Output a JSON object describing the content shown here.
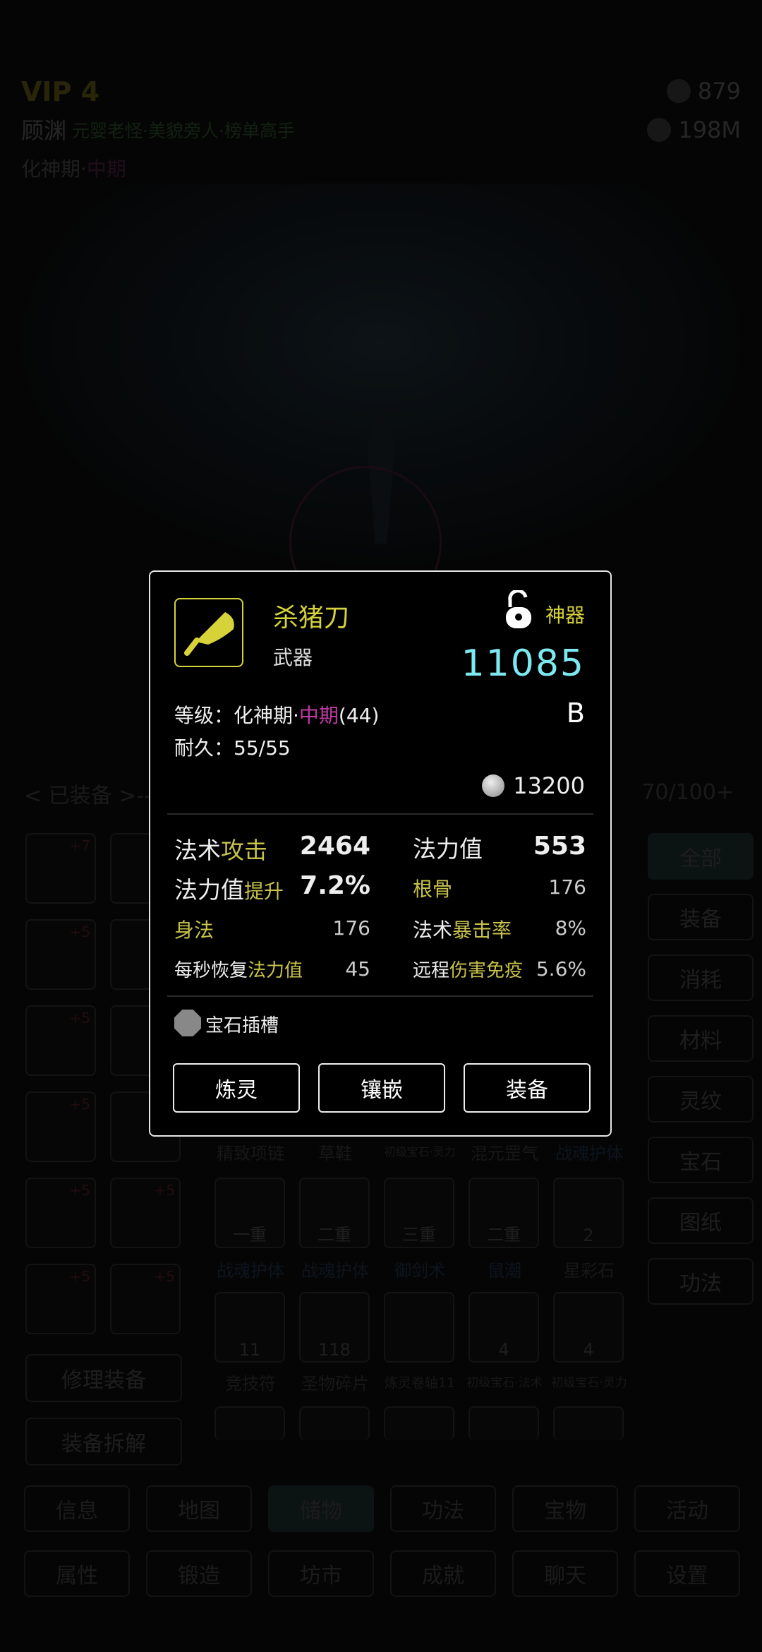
{
  "header": {
    "vip": "VIP 4",
    "player_name": "顾渊",
    "player_titles": "元婴老怪·美貌旁人·榜单高手",
    "realm_prefix": "化神期·",
    "realm_stage": "中期",
    "resource1": "879",
    "resource2": "198M"
  },
  "inventory": {
    "equipped_label": "< 已装备 >----",
    "capacity": "70/100+",
    "equipped_plus": [
      "+7",
      "",
      "+5",
      "",
      "+5",
      "",
      "+5",
      "",
      "+5",
      "+5",
      "+5",
      "+5"
    ],
    "filters": [
      "全部",
      "装备",
      "消耗",
      "材料",
      "灵纹",
      "宝石",
      "图纸",
      "功法"
    ],
    "row_labels_1": [
      "精致项链",
      "草鞋",
      "初级宝石·灵力",
      "混元罡气",
      "战魂护体"
    ],
    "row2_counts": [
      "一重",
      "二重",
      "三重",
      "二重",
      "2"
    ],
    "row_labels_2": [
      "战魂护体",
      "战魂护体",
      "御剑术",
      "鼠潮",
      "星彩石"
    ],
    "row3_counts": [
      "11",
      "118",
      "",
      "4",
      "4"
    ],
    "row_labels_3": [
      "竞技符",
      "圣物碎片",
      "炼灵卷轴11",
      "初级宝石·法术",
      "初级宝石·灵力"
    ],
    "repair_button": "修理装备",
    "dismantle_button": "装备拆解"
  },
  "nav": {
    "row1": [
      "信息",
      "地图",
      "储物",
      "功法",
      "宝物",
      "活动"
    ],
    "row2": [
      "属性",
      "锻造",
      "坊市",
      "成就",
      "聊天",
      "设置"
    ]
  },
  "item": {
    "name": "杀猪刀",
    "type": "武器",
    "grade": "神器",
    "power": "11085",
    "rank": "B",
    "level_prefix": "等级：化神期·",
    "level_stage": "中期",
    "level_suffix": "(44)",
    "durability": "耐久：55/55",
    "price": "13200",
    "stats": {
      "s1_a": "法术",
      "s1_b": "攻击",
      "s1_v": "2464",
      "s2_a": "法力值",
      "s2_v": "553",
      "s3_a": "法力值",
      "s3_b": "提升",
      "s3_v": "7.2%",
      "s4_b": "根骨",
      "s4_v": "176",
      "s5_b": "身法",
      "s5_v": "176",
      "s6_a": "法术",
      "s6_b": "暴击率",
      "s6_v": "8%",
      "s7_a": "每秒恢复",
      "s7_b": "法力值",
      "s7_v": "45",
      "s8_a": "远程",
      "s8_b": "伤害免疫",
      "s8_v": "5.6%"
    },
    "gem_slot": "宝石插槽",
    "buttons": [
      "炼灵",
      "镶嵌",
      "装备"
    ]
  }
}
